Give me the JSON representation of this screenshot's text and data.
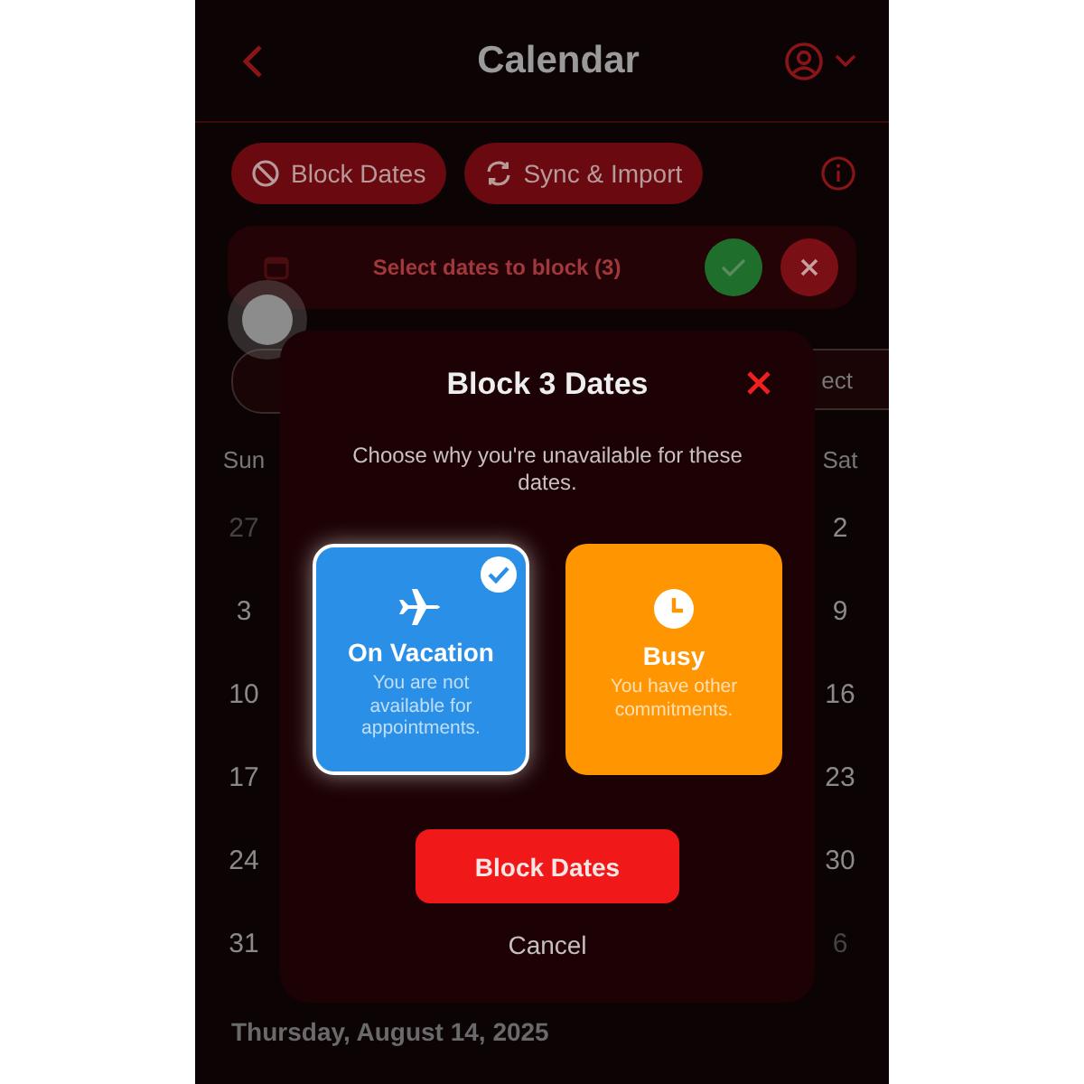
{
  "header": {
    "title": "Calendar"
  },
  "toolbar": {
    "buttons": [
      {
        "label": "Block Dates",
        "kind": "block"
      },
      {
        "label": "Sync & Import",
        "kind": "sync"
      }
    ]
  },
  "selection_bar": {
    "text": "Select dates to block (3)"
  },
  "filter_row": {
    "right_label": "ect"
  },
  "weekdays": [
    "Sun",
    "Sat"
  ],
  "weeks": [
    {
      "sun": {
        "day": "27",
        "outside_month": true
      },
      "sat": {
        "day": "2",
        "outside_month": false
      }
    },
    {
      "sun": {
        "day": "3",
        "outside_month": false
      },
      "sat": {
        "day": "9",
        "outside_month": false
      }
    },
    {
      "sun": {
        "day": "10",
        "outside_month": false
      },
      "sat": {
        "day": "16",
        "outside_month": false
      }
    },
    {
      "sun": {
        "day": "17",
        "outside_month": false
      },
      "sat": {
        "day": "23",
        "outside_month": false
      }
    },
    {
      "sun": {
        "day": "24",
        "outside_month": false
      },
      "sat": {
        "day": "30",
        "outside_month": false
      }
    },
    {
      "sun": {
        "day": "31",
        "outside_month": false
      },
      "sat": {
        "day": "6",
        "outside_month": true
      }
    }
  ],
  "selected_date": "Thursday, August 14, 2025",
  "dialog": {
    "title": "Block 3 Dates",
    "description": "Choose why you're unavailable for these dates.",
    "options": [
      {
        "title": "On Vacation",
        "description": "You are not available for appointments.",
        "kind": "vacation",
        "selected": true,
        "color": "#2a8fe6"
      },
      {
        "title": "Busy",
        "description": "You have other commitments.",
        "kind": "busy",
        "selected": false,
        "color": "#ff9500"
      }
    ],
    "confirm": "Block Dates",
    "cancel": "Cancel"
  }
}
